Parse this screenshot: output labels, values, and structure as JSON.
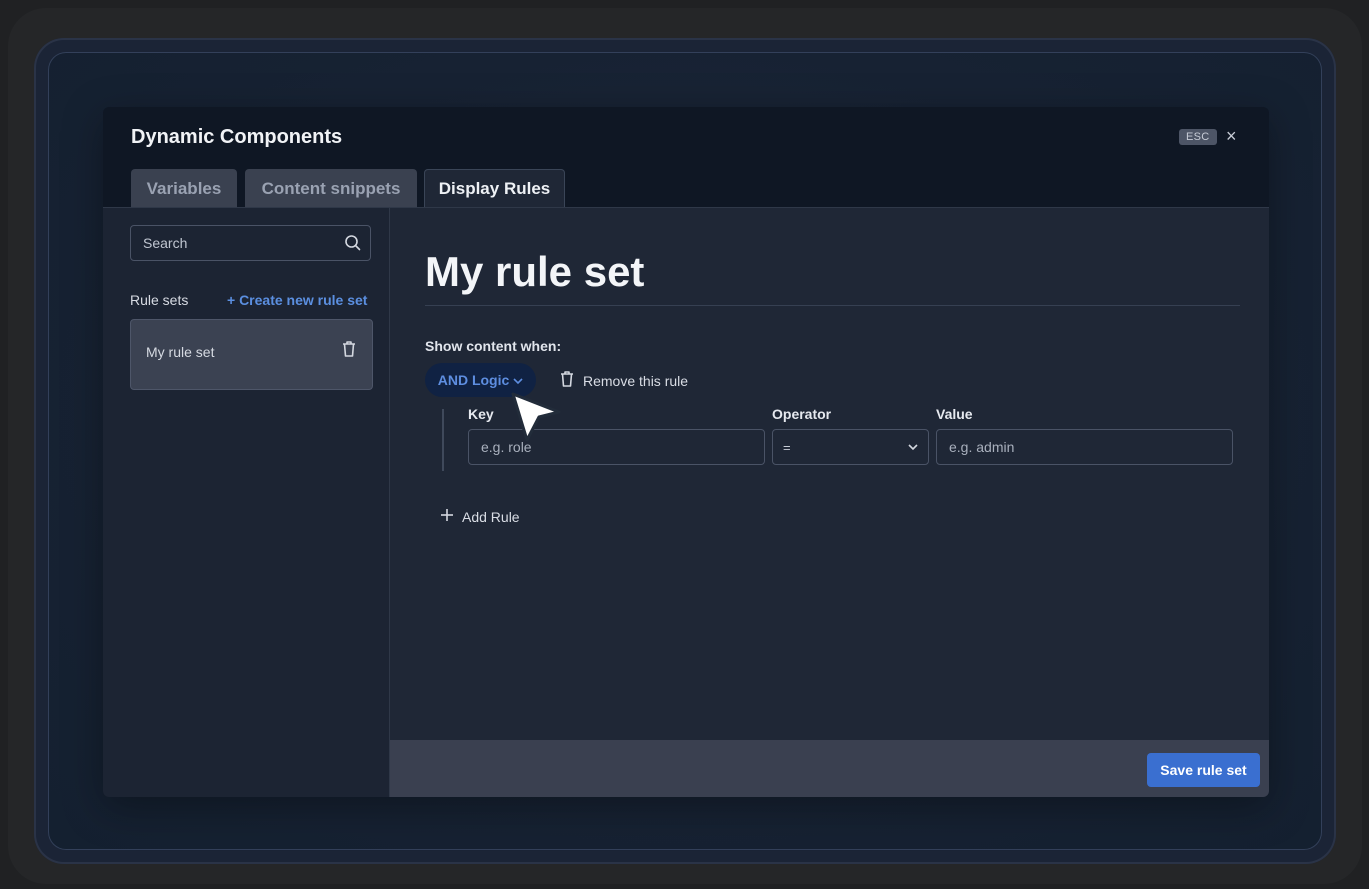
{
  "modal": {
    "title": "Dynamic Components",
    "esc_label": "ESC",
    "close_symbol": "×"
  },
  "tabs": [
    {
      "label": "Variables",
      "active": false
    },
    {
      "label": "Content snippets",
      "active": false
    },
    {
      "label": "Display Rules",
      "active": true
    }
  ],
  "sidebar": {
    "search_placeholder": "Search",
    "rule_sets_label": "Rule sets",
    "create_link": "+ Create new rule set",
    "items": [
      {
        "label": "My rule set",
        "selected": true
      }
    ]
  },
  "main": {
    "title": "My rule set",
    "show_label": "Show content when:",
    "logic_label": "AND Logic",
    "remove_label": "Remove this rule",
    "key_label": "Key",
    "key_placeholder": "e.g. role",
    "operator_label": "Operator",
    "operator_value": "=",
    "value_label": "Value",
    "value_placeholder": "e.g. admin",
    "add_rule_label": "Add Rule"
  },
  "footer": {
    "save_label": "Save rule set"
  },
  "colors": {
    "accent": "#3a6fd0",
    "link": "#5b8fe0",
    "modal_bg": "#0f1724",
    "panel_bg": "#1f2736"
  }
}
